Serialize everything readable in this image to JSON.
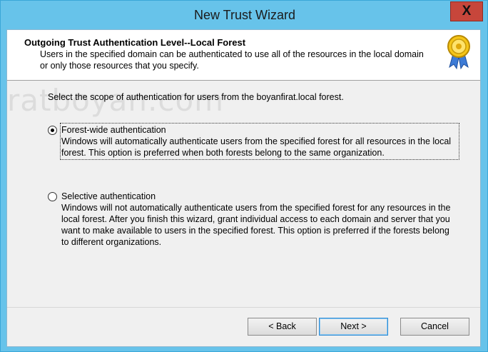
{
  "window": {
    "title": "New Trust Wizard",
    "close_label": "X"
  },
  "header": {
    "title": "Outgoing Trust Authentication Level--Local Forest",
    "description": "Users in the specified domain can be authenticated to use all of the resources in the local domain or only those resources that you specify."
  },
  "watermark": "ratboyan.com",
  "main": {
    "prompt": "Select the scope of authentication for users from the boyanfirat.local forest.",
    "options": [
      {
        "label": "Forest-wide authentication",
        "description": "Windows will automatically authenticate users from the specified forest for all resources in the local forest. This option is preferred when both forests belong to the same organization.",
        "selected": true
      },
      {
        "label": "Selective authentication",
        "description": "Windows will not automatically authenticate users from the specified forest for any resources in the local forest. After you finish this wizard, grant individual access to each domain and server that you want to make available to users in the specified forest. This option is preferred if the forests belong to different organizations.",
        "selected": false
      }
    ]
  },
  "buttons": {
    "back": "< Back",
    "next": "Next >",
    "cancel": "Cancel"
  }
}
